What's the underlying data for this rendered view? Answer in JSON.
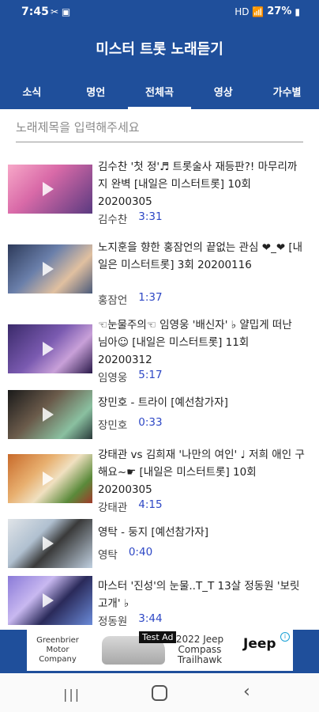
{
  "status_bar": {
    "time": "7:45",
    "left_icons": "✂ ▣",
    "right_icons": "HD 📶",
    "battery_pct": "27%"
  },
  "app": {
    "title": "미스터 트롯 노래듣기"
  },
  "tabs": [
    {
      "label": "소식"
    },
    {
      "label": "명언"
    },
    {
      "label": "전체곡"
    },
    {
      "label": "영상"
    },
    {
      "label": "가수별"
    }
  ],
  "active_tab": "전체곡",
  "search": {
    "placeholder": "노래제목을 입력해주세요",
    "value": ""
  },
  "songs": [
    {
      "title": "김수찬 '첫 정'♬ 트롯술사 재등판?! 마무리까지 완벽 [내일은 미스터트롯] 10회 20200305",
      "singer": "김수찬",
      "duration": "3:31"
    },
    {
      "title": "노지훈을 향한 홍잠언의 끝없는 관심 ❤_❤ [내일은 미스터트롯] 3회 20200116",
      "singer": "홍잠언",
      "duration": "1:37"
    },
    {
      "title": "☜눈물주의☜ 임영웅 '배신자' ♭ 얄밉게 떠난 님아☺ [내일은 미스터트롯] 11회 20200312",
      "singer": "임영웅",
      "duration": "5:17"
    },
    {
      "title": "장민호 - 트라이 [예선참가자]",
      "singer": "장민호",
      "duration": "0:33"
    },
    {
      "title": "강태관 vs 김희재 '나만의 여인' ♩ 저희 애인 구해요~☛ [내일은 미스터트롯] 10회 20200305",
      "singer": "강태관",
      "duration": "4:15"
    },
    {
      "title": "영탁 - 둥지 [예선참가자]",
      "singer": "영탁",
      "duration": "0:40"
    },
    {
      "title": "마스터 '진성'의 눈물..T_T 13살 정동원 '보릿고개' ♭",
      "singer": "정동원",
      "duration": "3:44"
    }
  ],
  "ad": {
    "label": "Test Ad",
    "left_text": "Greenbrier Motor Company",
    "mid_text": "2022 Jeep Compass Trailhawk",
    "logo_text": "Jeep",
    "info_icon": "i"
  },
  "navbar": {
    "recent": "|||",
    "back": "‹"
  }
}
